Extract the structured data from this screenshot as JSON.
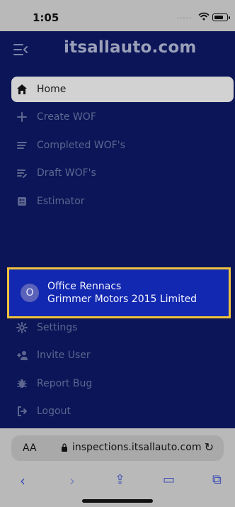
{
  "status_bar": {
    "time": "1:05",
    "dots": "....."
  },
  "app": {
    "brand": "itsallauto.com",
    "nav": {
      "items": [
        {
          "label": "Home",
          "active": true,
          "icon": "home-icon"
        },
        {
          "label": "Create WOF",
          "active": false,
          "icon": "plus-icon"
        },
        {
          "label": "Completed WOF's",
          "active": false,
          "icon": "list-icon"
        },
        {
          "label": "Draft WOF's",
          "active": false,
          "icon": "edit-list-icon"
        },
        {
          "label": "Estimator",
          "active": false,
          "icon": "calculator-icon"
        }
      ]
    },
    "user": {
      "avatar_initial": "O",
      "name": "Office Rennacs",
      "company": "Grimmer Motors 2015 Limited"
    },
    "nav_bottom": {
      "items": [
        {
          "label": "Settings",
          "icon": "gear-icon"
        },
        {
          "label": "Invite User",
          "icon": "add-user-icon"
        },
        {
          "label": "Report Bug",
          "icon": "bug-icon"
        },
        {
          "label": "Logout",
          "icon": "logout-icon"
        }
      ]
    }
  },
  "browser": {
    "aa_label": "AA",
    "url": "inspections.itsallauto.com"
  }
}
